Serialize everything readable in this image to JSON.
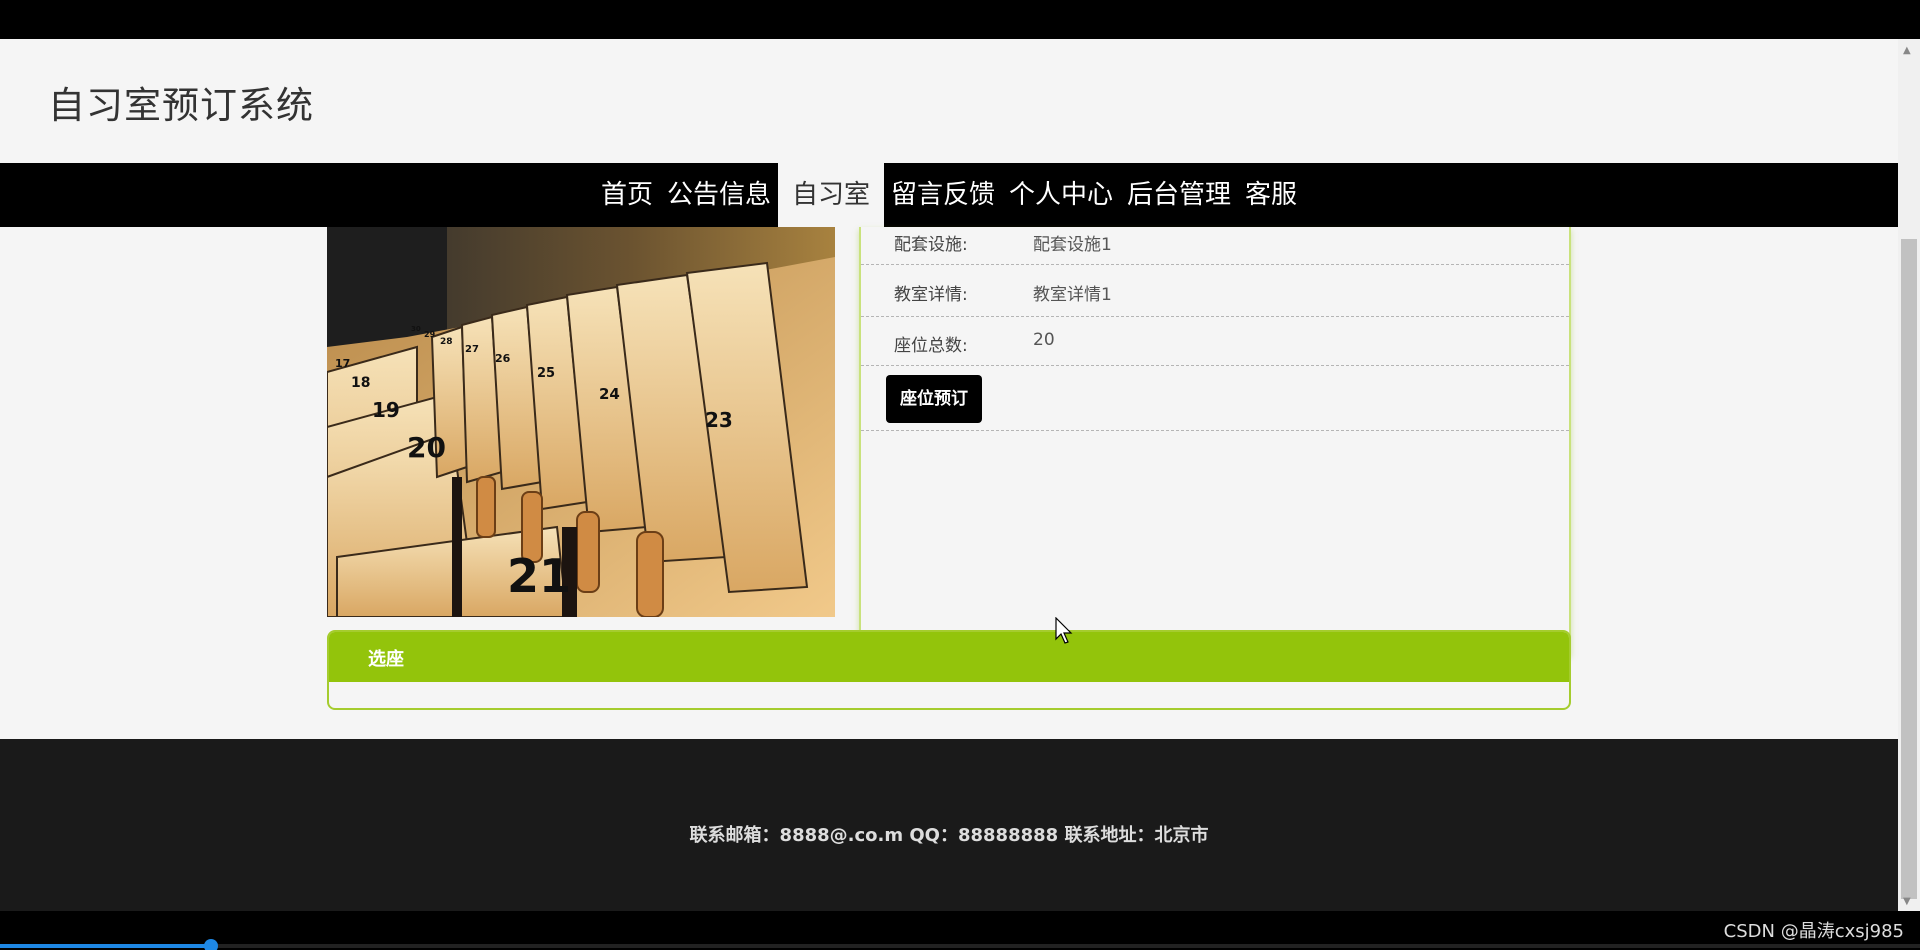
{
  "header": {
    "title": "自习室预订系统"
  },
  "nav": {
    "items": [
      {
        "label": "首页"
      },
      {
        "label": "公告信息"
      },
      {
        "label": "自习室"
      },
      {
        "label": "留言反馈"
      },
      {
        "label": "个人中心"
      },
      {
        "label": "后台管理"
      },
      {
        "label": "客服"
      }
    ],
    "active_index": 2
  },
  "room_image": {
    "seat_numbers": [
      "17",
      "18",
      "19",
      "20",
      "21",
      "23",
      "24",
      "25",
      "26",
      "27",
      "28",
      "29",
      "30"
    ]
  },
  "details": {
    "facilities_label": "配套设施:",
    "facilities_value": "配套设施1",
    "room_details_label": "教室详情:",
    "room_details_value": "教室详情1",
    "total_seats_label": "座位总数:",
    "total_seats_value": "20",
    "book_button": "座位预订"
  },
  "seat_panel": {
    "title": "选座"
  },
  "footer": {
    "contact": "联系邮箱：8888@.co.m QQ：88888888 联系地址：北京市"
  },
  "watermark": "CSDN @晶涛cxsj985",
  "video_progress": 0.11,
  "colors": {
    "accent_green": "#93c40b",
    "nav_bg": "#000000",
    "footer_bg": "#1a1a1a"
  }
}
